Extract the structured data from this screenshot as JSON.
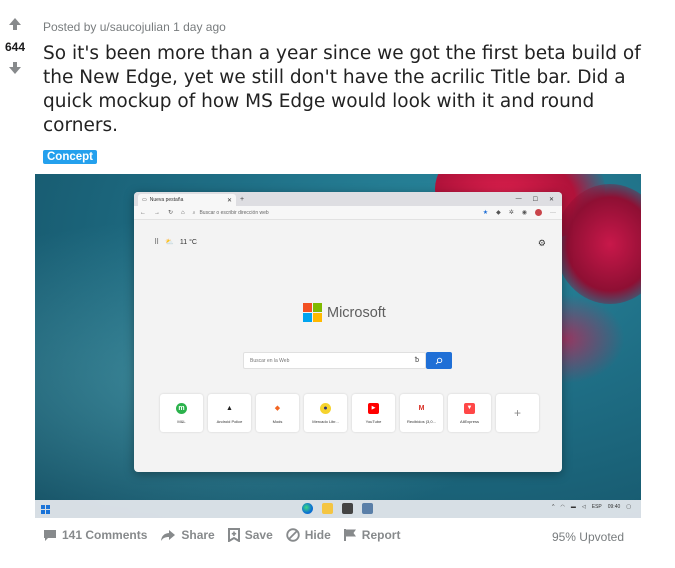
{
  "post": {
    "score": "644",
    "meta": "Posted by u/saucojulian 1 day ago",
    "title": "So it's been more than a year since we got the first beta build of the New Edge, yet we still don't have the acrilic Title bar. Did a quick mockup of how MS Edge would look with it and round corners.",
    "flair": "Concept",
    "flair_color": "#24a0ed",
    "upvoted": "95% Upvoted"
  },
  "actions": {
    "comments": "141 Comments",
    "share": "Share",
    "save": "Save",
    "hide": "Hide",
    "report": "Report"
  },
  "mockup": {
    "tab_title": "Nueva pestaña",
    "address_placeholder": "Buscar o escribir dirección web",
    "weather": "11 °C",
    "brand": "Microsoft",
    "search_placeholder": "Buscar en la Web",
    "tiles": [
      {
        "label": "M&L",
        "color": "#2bb24c",
        "glyph": "m"
      },
      {
        "label": "Android Police",
        "color": "#222222",
        "glyph": "▲"
      },
      {
        "label": "Mods",
        "color": "#f26522",
        "glyph": "◆"
      },
      {
        "label": "Mercado Libr...",
        "color": "#f6d32d",
        "glyph": "●"
      },
      {
        "label": "YouTube",
        "color": "#ff0000",
        "glyph": "▶"
      },
      {
        "label": "Recibidos (3,0...",
        "color": "#ffffff",
        "glyph": "M"
      },
      {
        "label": "AliExpress",
        "color": "#ff4747",
        "glyph": "▼"
      }
    ],
    "tray_lang": "ESP",
    "tray_time": "09:40"
  }
}
